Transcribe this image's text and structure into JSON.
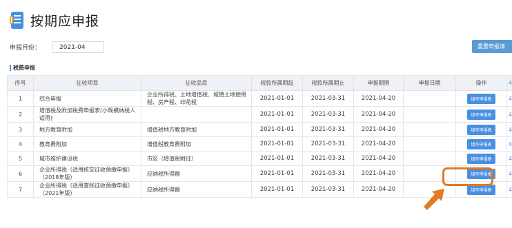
{
  "header": {
    "title": "按期应申报"
  },
  "period": {
    "label": "申报月份：",
    "value": "2021-04"
  },
  "reset_button": "重置申报清",
  "section": {
    "title": "税费申报"
  },
  "table": {
    "columns": [
      "序号",
      "征收项目",
      "征收品目",
      "税款所属期起",
      "税款所属期止",
      "申报期限",
      "申报日期",
      "操作",
      "4"
    ],
    "action_label": "填写申报表",
    "rows": [
      {
        "no": "1",
        "item": "综合申报",
        "subitem": "企业所得税、土地增值税、城镇土地使用税、房产税、印花税",
        "start": "2021-01-01",
        "end": "2021-03-31",
        "deadline": "2021-04-20",
        "date": "",
        "edge": "4"
      },
      {
        "no": "2",
        "item": "增值税及附加税费申报表(小规模纳税人适用)",
        "subitem": "",
        "start": "2021-01-01",
        "end": "2021-03-31",
        "deadline": "2021-04-20",
        "date": "",
        "edge": "4"
      },
      {
        "no": "3",
        "item": "地方教育附加",
        "subitem": "增值税地方教育附加",
        "start": "2021-01-01",
        "end": "2021-03-31",
        "deadline": "2021-04-20",
        "date": "",
        "edge": "4"
      },
      {
        "no": "4",
        "item": "教育费附加",
        "subitem": "增值税教育费附加",
        "start": "2021-01-01",
        "end": "2021-03-31",
        "deadline": "2021-04-20",
        "date": "",
        "edge": "4"
      },
      {
        "no": "5",
        "item": "城市维护建设税",
        "subitem": "市区（增值税附征）",
        "start": "2021-01-01",
        "end": "2021-03-31",
        "deadline": "2021-04-20",
        "date": "",
        "edge": "4"
      },
      {
        "no": "6",
        "item": "企业所得税（适用核定征收预缴申报）（2018年版）",
        "subitem": "应纳税所得额",
        "start": "2021-01-01",
        "end": "2021-03-31",
        "deadline": "2021-04-20",
        "date": "",
        "edge": "4"
      },
      {
        "no": "7",
        "item": "企业所得税（适用查账征收预缴申报）（2021年版）",
        "subitem": "应纳税所得额",
        "start": "2021-01-01",
        "end": "2021-03-31",
        "deadline": "2021-04-20",
        "date": "",
        "edge": "4"
      }
    ]
  },
  "colors": {
    "accent": "#4a90e2",
    "highlight": "#e07b23"
  }
}
